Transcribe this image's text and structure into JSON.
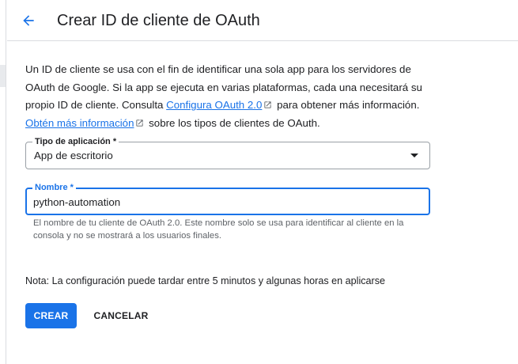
{
  "header": {
    "title": "Crear ID de cliente de OAuth",
    "back_icon": "arrow-back-icon"
  },
  "description": {
    "text_1": "Un ID de cliente se usa con el fin de identificar una sola app para los servidores de OAuth de Google. Si la app se ejecuta en varias plataformas, cada una necesitará su propio ID de cliente. Consulta ",
    "link_1": "Configura OAuth 2.0",
    "text_2": " para obtener más información. ",
    "link_2": "Obtén más información",
    "text_3": " sobre los tipos de clientes de OAuth."
  },
  "app_type": {
    "label": "Tipo de aplicación *",
    "value": "App de escritorio"
  },
  "name": {
    "label": "Nombre *",
    "value": "python-automation",
    "hint": "El nombre de tu cliente de OAuth 2.0. Este nombre solo se usa para identificar al cliente en la consola y no se mostrará a los usuarios finales."
  },
  "note": "Nota: La configuración puede tardar entre 5 minutos y algunas horas en aplicarse",
  "actions": {
    "create_label": "CREAR",
    "cancel_label": "CANCELAR"
  },
  "colors": {
    "accent": "#1a73e8",
    "text": "#202124",
    "secondary_text": "#5f6368",
    "border": "#9aa0a6"
  }
}
